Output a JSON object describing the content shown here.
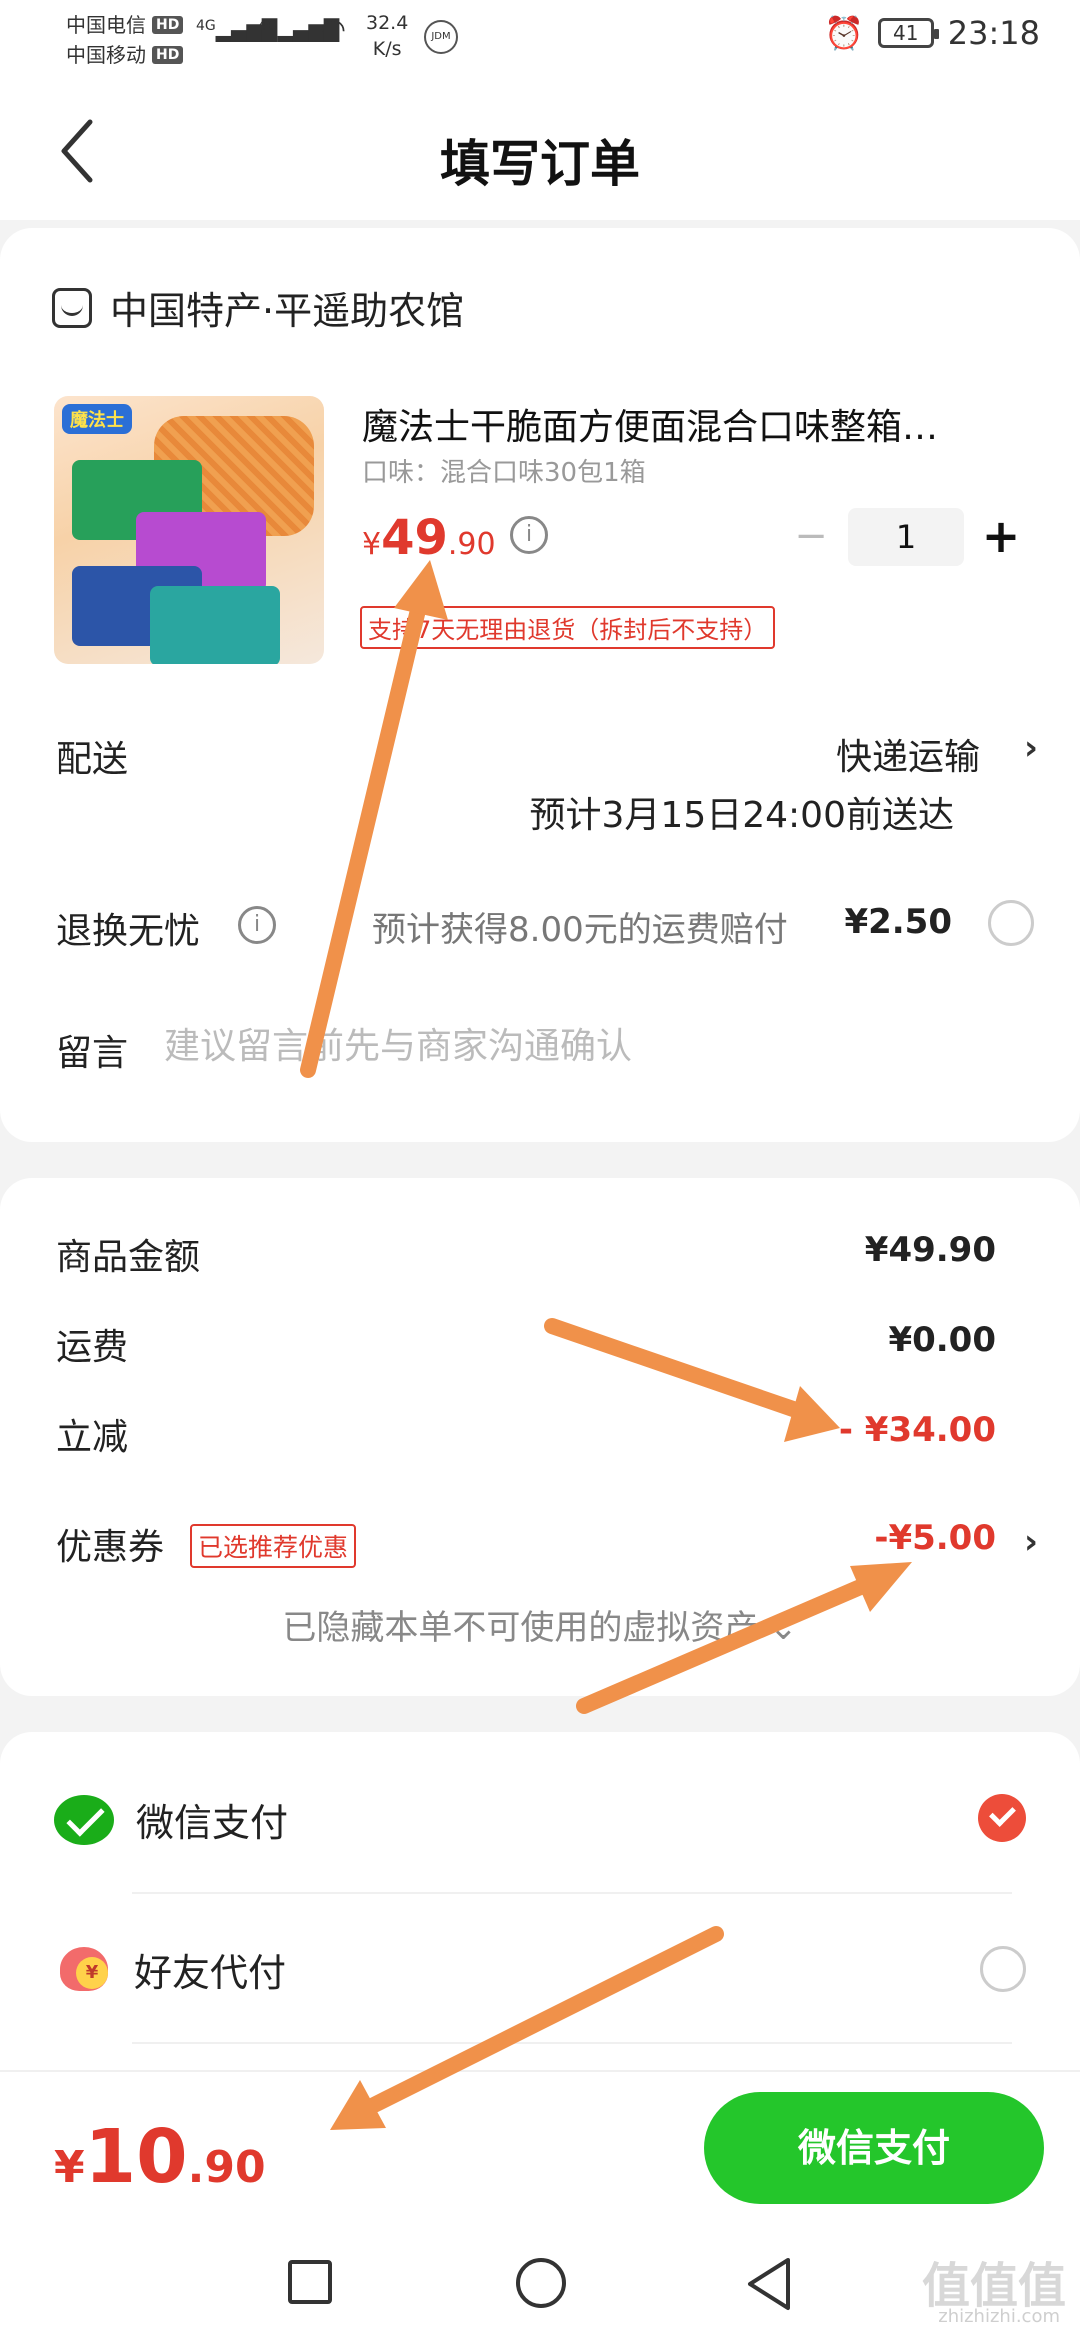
{
  "status_bar": {
    "carrier1": "中国电信",
    "carrier2": "中国移动",
    "hd": "HD",
    "net1": "4G",
    "net2": "4G",
    "speed_value": "32.4",
    "speed_unit": "K/s",
    "jdm": "JDM",
    "battery": "41",
    "time": "23:18"
  },
  "header": {
    "title": "填写订单"
  },
  "shop": {
    "name": "中国特产·平遥助农馆"
  },
  "product": {
    "brand_logo": "魔法士",
    "name": "魔法士干脆面方便面混合口味整箱…",
    "spec": "口味：混合口味30包1箱",
    "price_symbol": "¥",
    "price_int": "49",
    "price_dec": ".90",
    "info_icon": "i",
    "quantity": "1",
    "minus": "−",
    "plus": "+",
    "return_badge": "支持7天无理由退货（拆封后不支持）"
  },
  "delivery": {
    "label": "配送",
    "method": "快递运输",
    "eta": "预计3月15日24:00前送达",
    "chevron": "›"
  },
  "worry_free": {
    "label": "退换无忧",
    "info_icon": "i",
    "text": "预计获得8.00元的运费赔付",
    "price": "¥2.50"
  },
  "message": {
    "label": "留言",
    "placeholder": "建议留言前先与商家沟通确认"
  },
  "summary": {
    "goods_label": "商品金额",
    "goods_value": "¥49.90",
    "shipping_label": "运费",
    "shipping_value": "¥0.00",
    "discount_label": "立减",
    "discount_value": "- ¥34.00",
    "coupon_label": "优惠券",
    "coupon_tag": "已选推荐优惠",
    "coupon_value": "-¥5.00",
    "coupon_chevron": "›",
    "hidden_note": "已隐藏本单不可使用的虚拟资产 ⌄"
  },
  "payment": {
    "wechat_label": "微信支付",
    "wechat_selected": true,
    "friend_label": "好友代付",
    "friend_icon_text": "¥",
    "friend_selected": false
  },
  "pay_bar": {
    "total_symbol": "¥",
    "total_int": "10",
    "total_dec": ".90",
    "button": "微信支付"
  },
  "watermark": {
    "main": "值值值",
    "sub": "zhizhizhi.com"
  },
  "colors": {
    "accent_red": "#e0392d",
    "wechat_green": "#24c62b",
    "arrow_orange": "#f0914a"
  }
}
